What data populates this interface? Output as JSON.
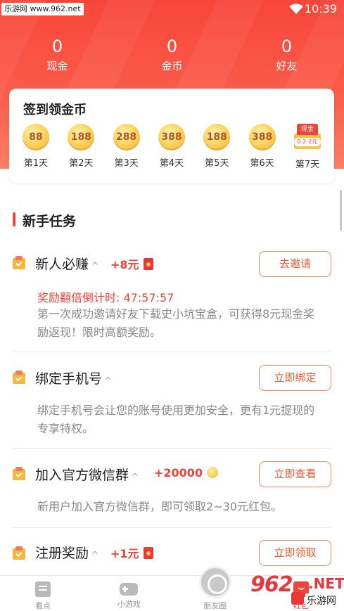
{
  "status_bar": {
    "site_badge": "乐游网 www.962.net",
    "time": "10:39"
  },
  "stats": [
    {
      "value": "0",
      "label": "现金"
    },
    {
      "value": "0",
      "label": "金币"
    },
    {
      "value": "0",
      "label": "好友"
    }
  ],
  "signin": {
    "title": "签到领金币",
    "days": [
      {
        "coins": "88",
        "label": "第1天"
      },
      {
        "coins": "188",
        "label": "第2天"
      },
      {
        "coins": "288",
        "label": "第3天"
      },
      {
        "coins": "388",
        "label": "第4天"
      },
      {
        "coins": "188",
        "label": "第5天"
      },
      {
        "coins": "388",
        "label": "第6天"
      }
    ],
    "day7": {
      "tag": "现金",
      "amount": "0.2-2元",
      "label": "第7天"
    }
  },
  "section": {
    "title": "新手任务"
  },
  "tasks": [
    {
      "title": "新人必赚",
      "chevron": "^",
      "reward": "+8元",
      "button": "去邀请",
      "countdown": "奖励翻倍倒计时:  47:57:57",
      "desc": "第一次成功邀请好友下载史小坑宝盒，可获得8元现金奖励返现！限时高额奖励。"
    },
    {
      "title": "绑定手机号",
      "chevron": "^",
      "button": "立即绑定",
      "desc": "绑定手机号会让您的账号使用更加安全，更有1元提现的专享特权。"
    },
    {
      "title": "加入官方微信群",
      "chevron": "^",
      "reward": "+20000",
      "button": "立即查看",
      "desc": "新用户加入官方微信群，即可领取2~30元红包。"
    },
    {
      "title": "注册奖励",
      "chevron": "^",
      "reward": "+1元",
      "button": "立即领取"
    }
  ],
  "nav": [
    {
      "label": "看点",
      "icon": "article-icon"
    },
    {
      "label": "小游戏",
      "icon": "gamepad-icon"
    },
    {
      "label": "朋友圈",
      "icon": "camera-shutter-icon"
    },
    {
      "label": "红包",
      "icon": "red-packet-icon"
    }
  ],
  "watermark": {
    "main": "962",
    "net": ".NET",
    "sub": "乐游网"
  },
  "colors": {
    "accent": "#f0443b",
    "button_text": "#f05a2e",
    "header_top": "#f8453a",
    "header_bottom": "#fb7e63"
  }
}
